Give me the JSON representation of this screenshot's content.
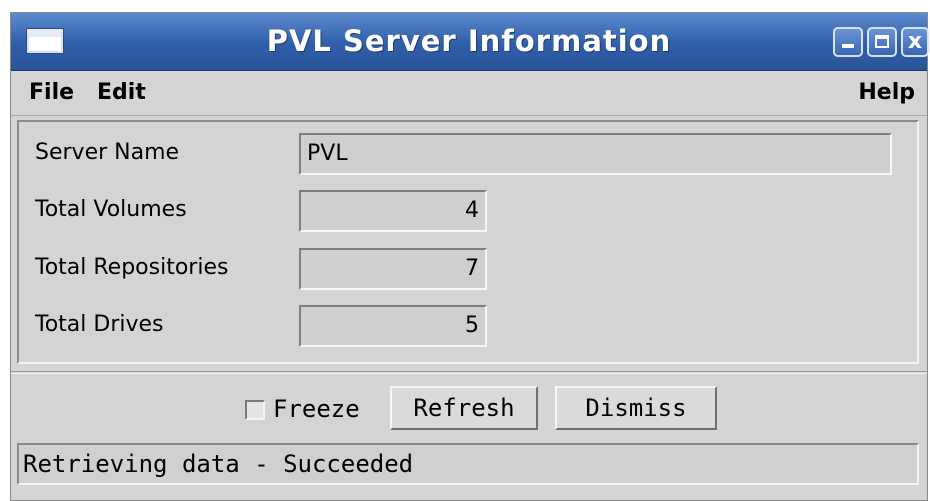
{
  "window": {
    "title": "PVL Server Information",
    "controls": {
      "minimize_icon": "minimize-icon",
      "maximize_icon": "maximize-icon",
      "close_icon": "close-icon",
      "close_glyph": "x"
    }
  },
  "menu": {
    "file": "File",
    "edit": "Edit",
    "help": "Help"
  },
  "fields": {
    "server_name": {
      "label": "Server Name",
      "value": "PVL"
    },
    "total_volumes": {
      "label": "Total Volumes",
      "value": "4"
    },
    "total_repositories": {
      "label": "Total Repositories",
      "value": "7"
    },
    "total_drives": {
      "label": "Total Drives",
      "value": "5"
    }
  },
  "controls": {
    "freeze_label": "Freeze",
    "freeze_checked": false,
    "refresh_label": "Refresh",
    "dismiss_label": "Dismiss"
  },
  "status": {
    "text": "Retrieving data - Succeeded"
  },
  "colors": {
    "titlebar": "#2f5ea8",
    "background": "#d4d4d4"
  }
}
